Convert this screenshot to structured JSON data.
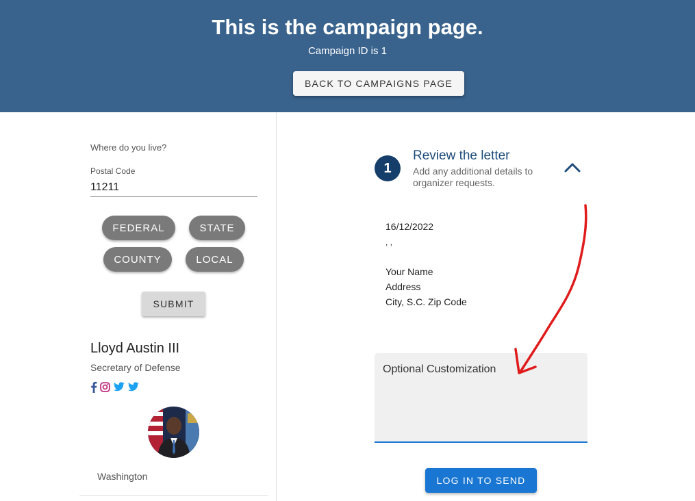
{
  "header": {
    "title": "This is the campaign page.",
    "subtitle": "Campaign ID is 1",
    "back_button": "BACK TO CAMPAIGNS PAGE"
  },
  "location_form": {
    "prompt": "Where do you live?",
    "postal_label": "Postal Code",
    "postal_value": "11211",
    "levels": [
      "FEDERAL",
      "STATE",
      "COUNTY",
      "LOCAL"
    ],
    "submit": "SUBMIT"
  },
  "representative": {
    "name": "Lloyd Austin III",
    "title": "Secretary of Defense",
    "location": "Washington",
    "social_icons": [
      "facebook-icon",
      "instagram-icon",
      "twitter-icon",
      "twitter-icon"
    ]
  },
  "step": {
    "number": "1",
    "title": "Review the letter",
    "description": "Add any additional details to organizer requests."
  },
  "letter": {
    "date": "16/12/2022",
    "recipient_line": ", ,",
    "sender_lines": [
      "Your Name",
      "Address",
      "City, S.C. Zip Code"
    ]
  },
  "customization": {
    "placeholder": "Optional Customization"
  },
  "send_button": "LOG IN TO SEND",
  "colors": {
    "header_bg": "#39628d",
    "pill_bg": "#7a7a7a",
    "primary": "#1976d2",
    "step_circle": "#153e6b",
    "annotation_arrow": "#e01b1b"
  }
}
